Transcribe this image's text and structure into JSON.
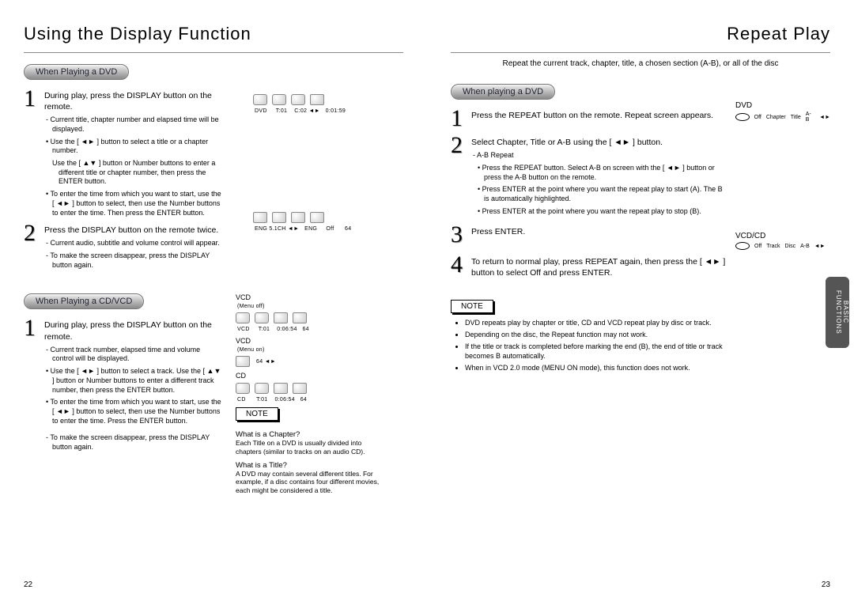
{
  "left": {
    "title": "Using the Display Function",
    "section1": {
      "heading": "When Playing a DVD",
      "step1": {
        "text": "During play, press the DISPLAY button on the remote.",
        "sub1": "- Current title, chapter number and elapsed time will be displayed.",
        "sub2": "• Use the [ ◄► ] button to select a title or a chapter number.",
        "sub3": "Use the [ ▲▼ ] button or Number buttons to enter a different title or chapter number, then press the ENTER button.",
        "sub4": "• To enter the time from which you want to start, use the [ ◄► ] button to select, then use the Number buttons to enter the time. Then press the ENTER button."
      },
      "step2": {
        "text": "Press the DISPLAY button on the remote twice.",
        "sub1": "- Current audio, subtitle and volume control will appear.",
        "sub2": "- To make the screen disappear, press the DISPLAY button again."
      },
      "iconrow1": {
        "c1": "DVD",
        "c2": "T:01",
        "c3": "C:02 ◄►",
        "c4": "0:01:59"
      },
      "iconrow2": {
        "c1": "ENG 5.1CH ◄►",
        "c2": "ENG",
        "c3": "Off",
        "c4": "64"
      }
    },
    "section2": {
      "heading": "When Playing a CD/VCD",
      "step1": {
        "text": "During play, press the DISPLAY button on the remote.",
        "sub1": "- Current track number, elapsed time and volume control will be displayed.",
        "sub2": "• Use the [ ◄► ] button to select a track. Use the [ ▲▼ ] button or Number buttons to enter a different track number, then press the ENTER button.",
        "sub3": "• To enter the time from which you want to start, use the [ ◄► ] button to select, then use the Number buttons to enter the time. Press the ENTER button.",
        "sub4": "- To make the screen disappear, press the DISPLAY button again."
      },
      "media": {
        "vcd_off": "VCD",
        "vcd_off_sub": "(Menu off)",
        "vcd_off_row": {
          "c1": "VCD",
          "c2": "T:01",
          "c3": "0:06:54",
          "c4": "64"
        },
        "vcd_on": "VCD",
        "vcd_on_sub": "(Menu on)",
        "vcd_on_row": {
          "c1": "64 ◄►"
        },
        "cd": "CD",
        "cd_row": {
          "c1": "CD",
          "c2": "T:01",
          "c3": "0:06:54",
          "c4": "64"
        }
      },
      "note": "NOTE",
      "qa1_h": "What is a Chapter?",
      "qa1_b": "Each Title on a DVD is usually divided into chapters (similar to tracks on an audio CD).",
      "qa2_h": "What is a Title?",
      "qa2_b": "A DVD may contain several different titles. For example, if a disc contains four different movies, each might be considered a title."
    },
    "page_num": "22"
  },
  "right": {
    "title": "Repeat Play",
    "intro": "Repeat the current track, chapter, title, a chosen section (A-B), or all of the disc",
    "section1": {
      "heading": "When playing a DVD",
      "step1": "Press the REPEAT button on the remote. Repeat screen appears.",
      "step2": "Select Chapter, Title or A-B using the [ ◄► ] button.",
      "step2_sub_h": "- A-B Repeat",
      "step2_sub1": "• Press the REPEAT button. Select A-B on screen with the [ ◄► ] button or press the A-B button on the remote.",
      "step2_sub2": "• Press ENTER at the point where you want the repeat play to start (A). The B is automatically highlighted.",
      "step2_sub3": "• Press ENTER at the point where you want the repeat play to stop (B).",
      "step3": "Press ENTER.",
      "step4": "To return to normal play, press REPEAT again, then press the [ ◄► ] button to select Off and press ENTER."
    },
    "dvd_label": "DVD",
    "dvd_bar": {
      "b1": "Off",
      "b2": "Chapter",
      "b3": "Title",
      "b4": "A-B",
      "b5": "◄►"
    },
    "vcd_label": "VCD/CD",
    "vcd_bar": {
      "b1": "Off",
      "b2": "Track",
      "b3": "Disc",
      "b4": "A-B",
      "b5": "◄►"
    },
    "note": "NOTE",
    "notes": {
      "n1": "DVD repeats play by chapter or title, CD and VCD repeat play by disc or track.",
      "n2": "Depending on the disc, the Repeat function may not work.",
      "n3": "If the title or track is completed before marking the end (B), the end of title or track becomes B automatically.",
      "n4": "When in VCD 2.0 mode (MENU ON mode), this function does not work."
    },
    "side_tab": "BASIC FUNCTIONS",
    "page_num": "23"
  }
}
